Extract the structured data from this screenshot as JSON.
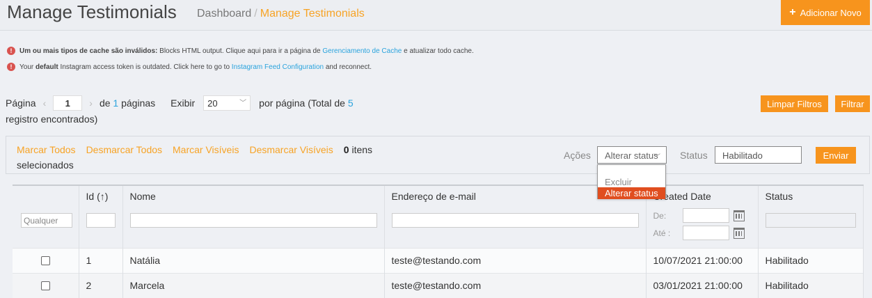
{
  "header": {
    "title": "Manage Testimonials",
    "breadcrumb_home": "Dashboard",
    "breadcrumb_sep": "/",
    "breadcrumb_current": "Manage Testimonials",
    "add_button": "Adicionar Novo"
  },
  "messages": [
    {
      "bold": "Um ou mais tipos de cache são inválidos:",
      "text": " Blocks HTML output. Clique aqui para ir a página de ",
      "link": "Gerenciamento de Cache",
      "after": " e atualizar todo cache."
    },
    {
      "prefix": "Your ",
      "bold": "default",
      "text": " Instagram access token is outdated. Click here to go to ",
      "link": "Instagram Feed Configuration",
      "after": " and reconnect."
    }
  ],
  "pager": {
    "page_label": "Página",
    "prev": "‹",
    "page_value": "1",
    "next": "›",
    "of_label": "de",
    "total_pages": "1",
    "pages_label": "páginas",
    "show_label": "Exibir",
    "per_page": "20",
    "per_page_label": "por página (Total de",
    "total_records": "5",
    "records_label": "registro encontrados)"
  },
  "buttons": {
    "clear_filters": "Limpar Filtros",
    "filter": "Filtrar",
    "submit": "Enviar"
  },
  "massaction": {
    "select_all": "Marcar Todos",
    "unselect_all": "Desmarcar Todos",
    "select_visible": "Marcar Visíveis",
    "unselect_visible": "Desmarcar Visíveis",
    "count": "0",
    "count_label": " itens selecionados",
    "actions_label": "Ações",
    "actions_value": "Alterar status",
    "status_label": "Status",
    "status_value": "Habilitado",
    "dropdown_options": [
      "Excluir",
      "Alterar status"
    ]
  },
  "grid": {
    "columns": [
      "",
      "Id (↑)",
      "Nome",
      "Endereço de e-mail",
      "Created Date",
      "Status"
    ],
    "filter_any": "Qualquer",
    "date_from": "De:",
    "date_to": "Até :",
    "rows": [
      {
        "id": "1",
        "name": "Natália",
        "email": "teste@testando.com",
        "date": "10/07/2021 21:00:00",
        "status": "Habilitado"
      },
      {
        "id": "2",
        "name": "Marcela",
        "email": "teste@testando.com",
        "date": "03/01/2021 21:00:00",
        "status": "Habilitado"
      }
    ]
  },
  "colors": {
    "accent": "#f7941d",
    "link": "#2aa3dd",
    "error": "#d9534f",
    "highlight": "#e04e1f"
  }
}
